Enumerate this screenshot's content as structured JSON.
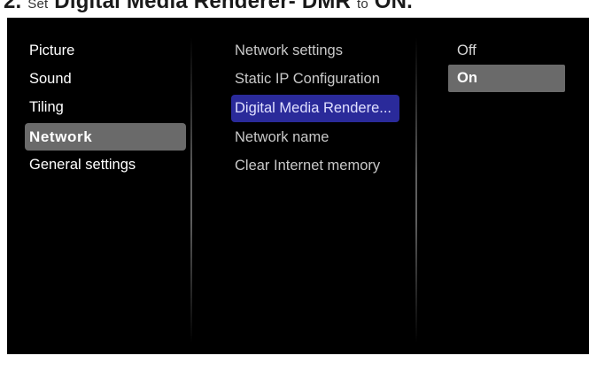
{
  "caption": {
    "prefix": "2.",
    "small": "Set",
    "title": "Digital Media Renderer- DMR",
    "connector": "to",
    "value": "ON."
  },
  "menu": {
    "level1": [
      {
        "label": "Picture"
      },
      {
        "label": "Sound"
      },
      {
        "label": "Tiling"
      },
      {
        "label": "Network",
        "selected": true
      },
      {
        "label": "General settings"
      }
    ],
    "level2": [
      {
        "label": "Network settings"
      },
      {
        "label": "Static IP Configuration"
      },
      {
        "label": "Digital Media Rendere...",
        "highlighted": true
      },
      {
        "label": "Network name"
      },
      {
        "label": "Clear Internet memory"
      }
    ],
    "level3": [
      {
        "label": "Off"
      },
      {
        "label": "On",
        "selected": true
      }
    ]
  },
  "colors": {
    "background": "#000000",
    "selection_gray": "#6a6a6a",
    "highlight_blue": "#2a2a9a",
    "text": "#ffffff"
  }
}
